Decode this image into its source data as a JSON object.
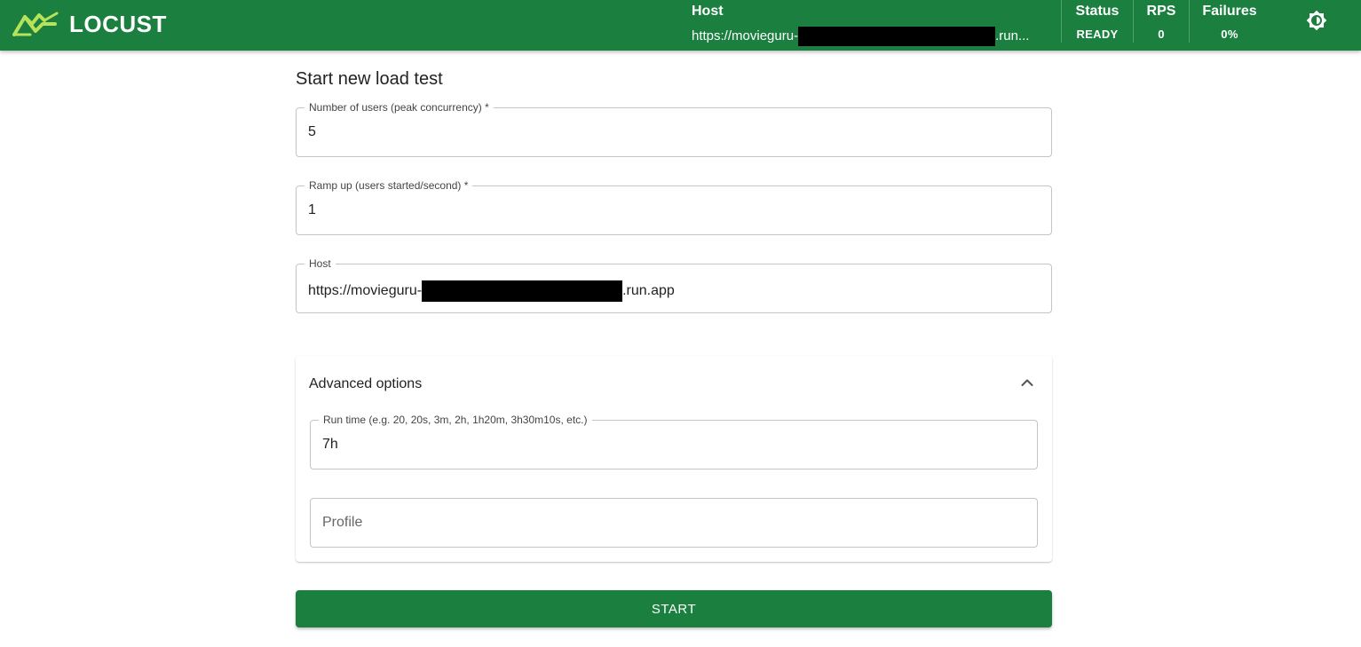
{
  "header": {
    "logo_text": "LOCUST",
    "logo_icon": "locust-grasshopper-icon",
    "host_label": "Host",
    "host_prefix": "https://movieguru-",
    "host_suffix": ".run...",
    "status_label": "Status",
    "status_value": "READY",
    "rps_label": "RPS",
    "rps_value": "0",
    "failures_label": "Failures",
    "failures_value": "0%",
    "theme_icon": "brightness-toggle-icon"
  },
  "form": {
    "title": "Start new load test",
    "users": {
      "label": "Number of users (peak concurrency) *",
      "value": "5"
    },
    "ramp_up": {
      "label": "Ramp up (users started/second) *",
      "value": "1"
    },
    "host": {
      "label": "Host",
      "value_prefix": "https://movieguru-",
      "value_suffix": ".run.app"
    }
  },
  "advanced": {
    "title": "Advanced options",
    "expanded": true,
    "chevron_icon": "chevron-up-icon",
    "run_time": {
      "label": "Run time (e.g. 20, 20s, 3m, 2h, 1h20m, 3h30m10s, etc.)",
      "value": "7h"
    },
    "profile": {
      "placeholder": "Profile",
      "value": ""
    }
  },
  "start_button": {
    "label": "START"
  },
  "colors": {
    "brand_green": "#1a7f3f",
    "redaction": "#000000"
  }
}
